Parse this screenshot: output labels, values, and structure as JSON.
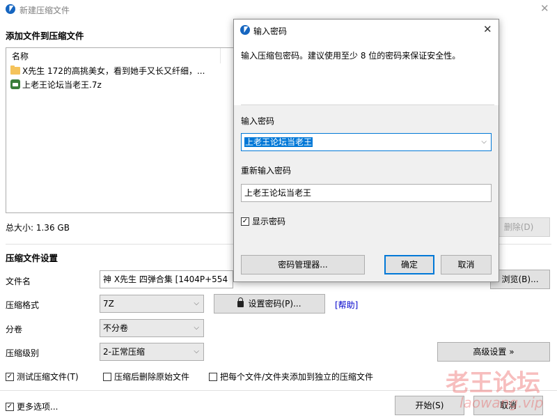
{
  "app": {
    "title": "新建压缩文件",
    "close_symbol": "✕"
  },
  "add_section": {
    "heading": "添加文件到压缩文件",
    "list_header": "名称",
    "items": [
      {
        "icon": "folder-icon",
        "name": "X先生 172的高挑美女，看到她手又长又纤细，..."
      },
      {
        "icon": "archive-icon",
        "name": "上老王论坛当老王.7z"
      }
    ],
    "total_size": "总大小: 1.36 GB",
    "delete_button": "删除(D)"
  },
  "settings": {
    "heading": "压缩文件设置",
    "filename_label": "文件名",
    "filename_value": "神 X先生 四弹合集 [1404P+554",
    "browse_button": "浏览(B)...",
    "format_label": "压缩格式",
    "format_value": "7Z",
    "set_password_button": "设置密码(P)...",
    "help_link": "[帮助]",
    "volume_label": "分卷",
    "volume_value": "不分卷",
    "level_label": "压缩级别",
    "level_value": "2-正常压缩",
    "advanced_button": "高级设置 »",
    "test_checkbox": "测试压缩文件(T)",
    "test_checked": true,
    "delete_after_checkbox": "压缩后删除原始文件",
    "delete_after_checked": false,
    "separate_checkbox": "把每个文件/文件夹添加到独立的压缩文件",
    "separate_checked": false
  },
  "footer": {
    "more_options": "更多选项...",
    "more_options_checked": true,
    "start_button": "开始(S)",
    "cancel_button": "取消"
  },
  "dialog": {
    "title": "输入密码",
    "close_symbol": "✕",
    "description": "输入压缩包密码。建议使用至少 8 位的密码来保证安全性。",
    "password_label": "输入密码",
    "password_value": "上老王论坛当老王",
    "repeat_label": "重新输入密码",
    "repeat_value": "上老王论坛当老王",
    "show_password": "显示密码",
    "show_password_checked": true,
    "manager_button": "密码管理器...",
    "ok_button": "确定",
    "cancel_button": "取消"
  },
  "watermark": {
    "line1": "老王论坛",
    "line2": "laowang.vip"
  }
}
